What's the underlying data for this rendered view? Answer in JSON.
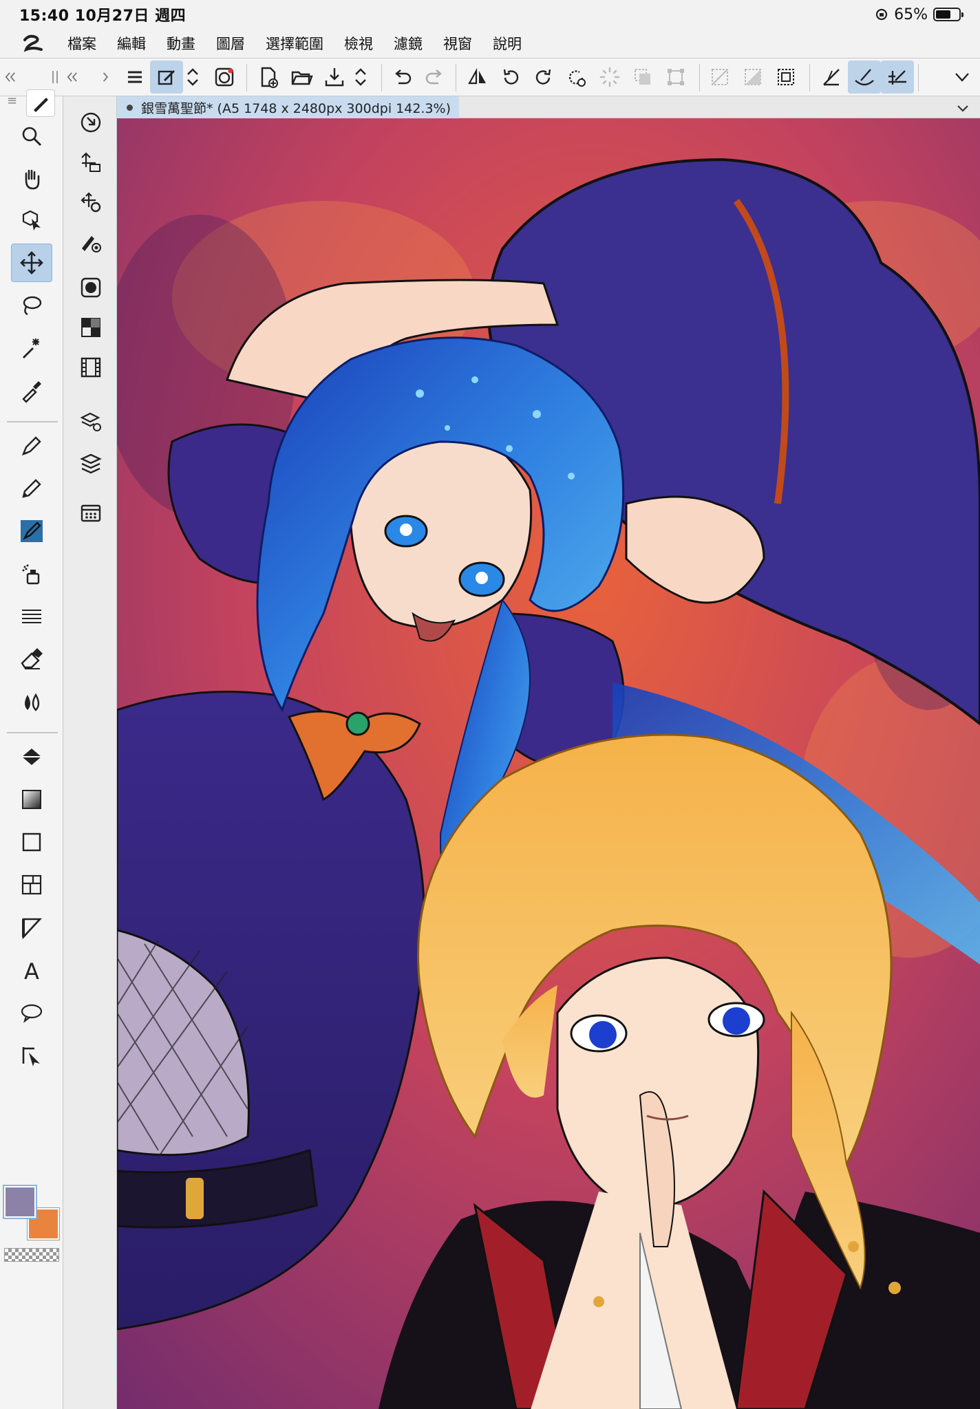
{
  "status_bar": {
    "time_date": "15:40  10月27日 週四",
    "battery": "65%",
    "battery_level": 0.65
  },
  "menu": {
    "items": [
      "檔案",
      "編輯",
      "動畫",
      "圖層",
      "選擇範圍",
      "檢視",
      "濾鏡",
      "視窗",
      "說明"
    ]
  },
  "document": {
    "tab_label": "銀雪萬聖節* (A5 1748 x 2480px 300dpi 142.3%)"
  },
  "colors": {
    "main": "#8c82a8",
    "sub": "#e9843f",
    "selected_highlight": "#bcd3ea"
  },
  "tools": [
    "zoom-icon",
    "hand-icon",
    "object-select-icon",
    "move-icon",
    "lasso-icon",
    "magic-wand-icon",
    "eyedropper-icon",
    "pen-icon",
    "pencil-icon",
    "brush-icon",
    "airbrush-icon",
    "decoration-icon",
    "eraser-icon",
    "blend-icon",
    "fill-icon",
    "gradient-icon",
    "rectangle-icon",
    "frame-icon",
    "ruler-icon",
    "text-icon",
    "balloon-icon",
    "line-correction-icon"
  ]
}
